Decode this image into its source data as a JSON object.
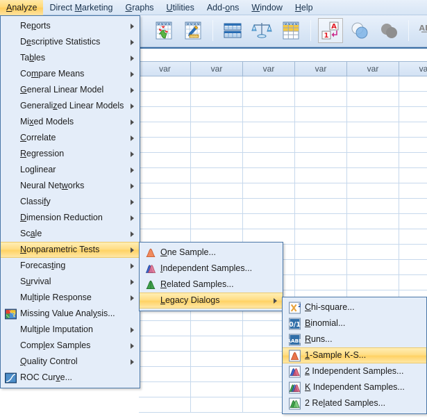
{
  "menubar": {
    "items": [
      {
        "label": "Analyze",
        "pre": "",
        "acc": "A",
        "post": "nalyze",
        "active": true
      },
      {
        "label": "Direct Marketing",
        "pre": "Direct ",
        "acc": "M",
        "post": "arketing",
        "active": false
      },
      {
        "label": "Graphs",
        "pre": "",
        "acc": "G",
        "post": "raphs",
        "active": false
      },
      {
        "label": "Utilities",
        "pre": "",
        "acc": "U",
        "post": "tilities",
        "active": false
      },
      {
        "label": "Add-ons",
        "pre": "Add-",
        "acc": "o",
        "post": "ns",
        "active": false
      },
      {
        "label": "Window",
        "pre": "",
        "acc": "W",
        "post": "indow",
        "active": false
      },
      {
        "label": "Help",
        "pre": "",
        "acc": "H",
        "post": "elp",
        "active": false
      }
    ]
  },
  "toolbar": {
    "buttons": [
      {
        "name": "goto-case-icon",
        "title": "Go to case"
      },
      {
        "name": "goto-variable-icon",
        "title": "Go to variable"
      },
      {
        "name": "variables-icon",
        "title": "Variables"
      },
      {
        "name": "weight-cases-icon",
        "title": "Weight cases"
      },
      {
        "name": "split-file-icon",
        "title": "Split file"
      },
      {
        "name": "value-labels-icon",
        "title": "Value labels"
      },
      {
        "name": "use-variable-sets-icon",
        "title": "Use variable sets"
      },
      {
        "name": "show-all-variables-icon",
        "title": "Show all variables"
      },
      {
        "name": "spell-check-icon",
        "title": "Spell check"
      }
    ]
  },
  "sheet": {
    "column_header_label": "var",
    "column_count": 6,
    "row_count": 22
  },
  "colors": {
    "highlight": "#ffd978",
    "menu_background": "#e4edf9",
    "menu_border": "#4a77a8",
    "grid_header": "#d9e6f5"
  },
  "menus": {
    "analyze": {
      "name": "Analyze",
      "items": [
        {
          "pre": "Re",
          "acc": "p",
          "post": "orts",
          "submenu": true,
          "icon": null,
          "highlighted": false
        },
        {
          "pre": "D",
          "acc": "e",
          "post": "scriptive Statistics",
          "submenu": true,
          "icon": null,
          "highlighted": false
        },
        {
          "pre": "Ta",
          "acc": "b",
          "post": "les",
          "submenu": true,
          "icon": null,
          "highlighted": false
        },
        {
          "pre": "Co",
          "acc": "m",
          "post": "pare Means",
          "submenu": true,
          "icon": null,
          "highlighted": false
        },
        {
          "pre": "",
          "acc": "G",
          "post": "eneral Linear Model",
          "submenu": true,
          "icon": null,
          "highlighted": false
        },
        {
          "pre": "Generali",
          "acc": "z",
          "post": "ed Linear Models",
          "submenu": true,
          "icon": null,
          "highlighted": false
        },
        {
          "pre": "Mi",
          "acc": "x",
          "post": "ed Models",
          "submenu": true,
          "icon": null,
          "highlighted": false
        },
        {
          "pre": "",
          "acc": "C",
          "post": "orrelate",
          "submenu": true,
          "icon": null,
          "highlighted": false
        },
        {
          "pre": "",
          "acc": "R",
          "post": "egression",
          "submenu": true,
          "icon": null,
          "highlighted": false
        },
        {
          "pre": "Lo",
          "acc": "g",
          "post": "linear",
          "submenu": true,
          "icon": null,
          "highlighted": false
        },
        {
          "pre": "Neural Net",
          "acc": "w",
          "post": "orks",
          "submenu": true,
          "icon": null,
          "highlighted": false
        },
        {
          "pre": "Classi",
          "acc": "f",
          "post": "y",
          "submenu": true,
          "icon": null,
          "highlighted": false
        },
        {
          "pre": "",
          "acc": "D",
          "post": "imension Reduction",
          "submenu": true,
          "icon": null,
          "highlighted": false
        },
        {
          "pre": "Sc",
          "acc": "a",
          "post": "le",
          "submenu": true,
          "icon": null,
          "highlighted": false
        },
        {
          "pre": "",
          "acc": "N",
          "post": "onparametric Tests",
          "submenu": true,
          "icon": null,
          "highlighted": true
        },
        {
          "pre": "Forecas",
          "acc": "t",
          "post": "ing",
          "submenu": true,
          "icon": null,
          "highlighted": false
        },
        {
          "pre": "S",
          "acc": "u",
          "post": "rvival",
          "submenu": true,
          "icon": null,
          "highlighted": false
        },
        {
          "pre": "Mu",
          "acc": "l",
          "post": "tiple Response",
          "submenu": true,
          "icon": null,
          "highlighted": false
        },
        {
          "pre": "Missing Value Anal",
          "acc": "y",
          "post": "sis...",
          "submenu": false,
          "icon": "missing-value-analysis-icon",
          "highlighted": false
        },
        {
          "pre": "Mult",
          "acc": "i",
          "post": "ple Imputation",
          "submenu": true,
          "icon": null,
          "highlighted": false
        },
        {
          "pre": "Comp",
          "acc": "l",
          "post": "ex Samples",
          "submenu": true,
          "icon": null,
          "highlighted": false
        },
        {
          "pre": "",
          "acc": "Q",
          "post": "uality Control",
          "submenu": true,
          "icon": null,
          "highlighted": false
        },
        {
          "pre": "ROC Cur",
          "acc": "v",
          "post": "e...",
          "submenu": false,
          "icon": "roc-curve-icon",
          "highlighted": false
        }
      ]
    },
    "nonparametric_tests": {
      "name": "Nonparametric Tests",
      "items": [
        {
          "pre": "",
          "acc": "O",
          "post": "ne Sample...",
          "submenu": false,
          "icon": "one-sample-icon",
          "highlighted": false
        },
        {
          "pre": "",
          "acc": "I",
          "post": "ndependent Samples...",
          "submenu": false,
          "icon": "independent-samples-icon",
          "highlighted": false
        },
        {
          "pre": "",
          "acc": "R",
          "post": "elated Samples...",
          "submenu": false,
          "icon": "related-samples-icon",
          "highlighted": false
        },
        {
          "pre": "",
          "acc": "L",
          "post": "egacy Dialogs",
          "submenu": true,
          "icon": null,
          "highlighted": true
        }
      ]
    },
    "legacy_dialogs": {
      "name": "Legacy Dialogs",
      "items": [
        {
          "pre": "",
          "acc": "C",
          "post": "hi-square...",
          "submenu": false,
          "icon": "chi-square-icon",
          "highlighted": false
        },
        {
          "pre": "",
          "acc": "B",
          "post": "inomial...",
          "submenu": false,
          "icon": "binomial-icon",
          "highlighted": false
        },
        {
          "pre": "",
          "acc": "R",
          "post": "uns...",
          "submenu": false,
          "icon": "runs-icon",
          "highlighted": false
        },
        {
          "pre": "",
          "acc": "1",
          "post": "-Sample K-S...",
          "submenu": false,
          "icon": "one-sample-ks-icon",
          "highlighted": true
        },
        {
          "pre": "",
          "acc": "2",
          "post": " Independent Samples...",
          "submenu": false,
          "icon": "two-independent-samples-icon",
          "highlighted": false
        },
        {
          "pre": "",
          "acc": "K",
          "post": " Independent Samples...",
          "submenu": false,
          "icon": "k-independent-samples-icon",
          "highlighted": false
        },
        {
          "pre": "2 Re",
          "acc": "l",
          "post": "ated Samples...",
          "submenu": false,
          "icon": "two-related-samples-icon",
          "highlighted": false
        }
      ]
    }
  }
}
